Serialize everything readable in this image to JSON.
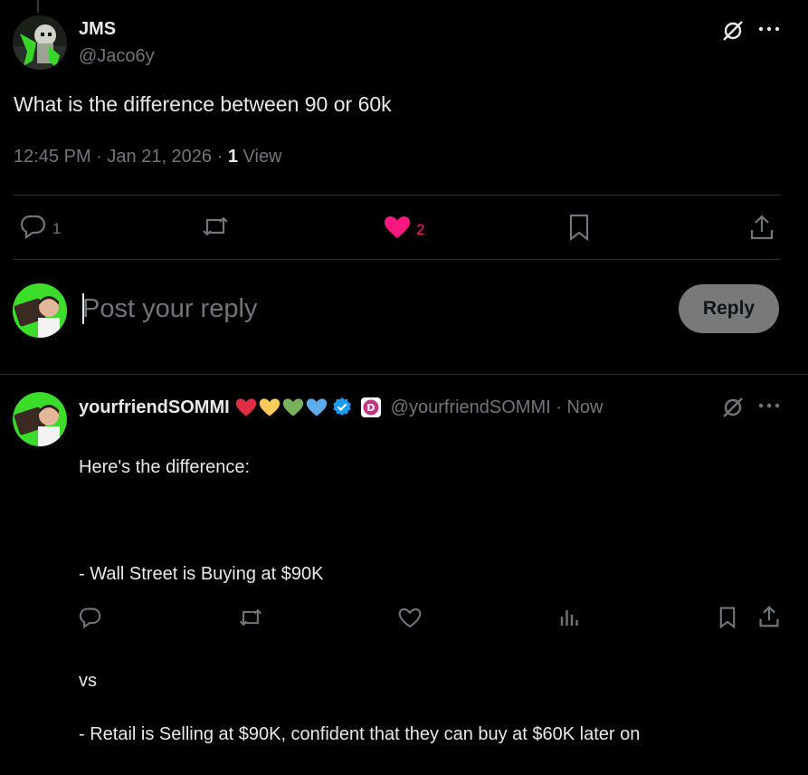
{
  "tweet": {
    "author_name": "JMS",
    "author_handle": "@Jaco6y",
    "text": "What is the difference between 90 or 60k",
    "time": "12:45 PM",
    "date": "Jan 21, 2026",
    "view_count": "1",
    "view_label": "View",
    "reply_count": "1",
    "like_count": "2",
    "like_color": "#f91880"
  },
  "composer": {
    "placeholder": "Post your reply",
    "button_label": "Reply"
  },
  "reply": {
    "author_name": "yourfriendSOMMI",
    "author_handle": "@yourfriendSOMMI",
    "time": "Now",
    "emojis": [
      "red-heart",
      "yellow-heart",
      "green-heart",
      "blue-heart"
    ],
    "text_lines": [
      "Here's the difference:",
      "",
      "- Wall Street is Buying at $90K",
      "",
      "vs",
      "- Retail is Selling at $90K, confident that they can buy at $60K later on"
    ]
  },
  "icons": {
    "grok": "grok-icon",
    "more": "more-icon",
    "reply": "reply-icon",
    "repost": "repost-icon",
    "like": "heart-icon",
    "bookmark": "bookmark-icon",
    "share": "share-icon",
    "analytics": "analytics-icon",
    "verified": "verified-badge-icon"
  }
}
